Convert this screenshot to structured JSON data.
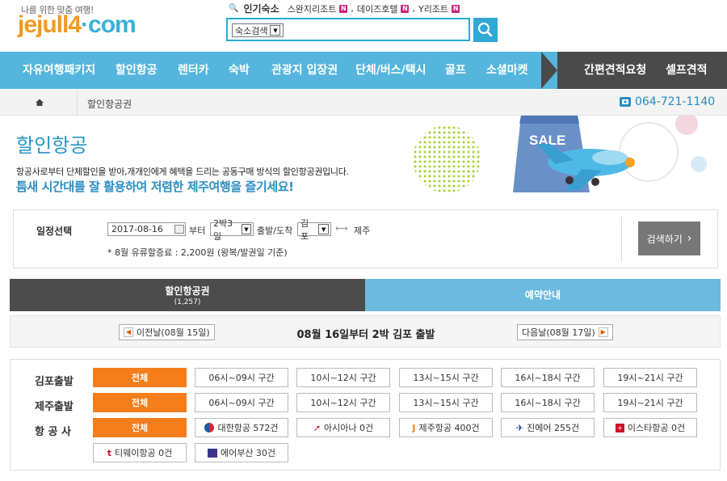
{
  "brand": {
    "tagline": "나를 위한 맞춤 여행!",
    "logo_a": "jejull4",
    "logo_dot": "·",
    "logo_b": "com"
  },
  "popular": {
    "title": "인기숙소",
    "items": [
      "스완지리조트",
      "데이즈호텔",
      "Y리조트"
    ],
    "badge": "N"
  },
  "search": {
    "select_value": "숙소검색"
  },
  "nav": {
    "items": [
      "자유여행패키지",
      "할인항공",
      "렌터카",
      "숙박",
      "관광지 입장권",
      "단체/버스/택시",
      "골프",
      "소셜마켓"
    ],
    "right": [
      "간편견적요청",
      "셀프견적"
    ]
  },
  "breadcrumb": {
    "current": "할인항공권",
    "phone": "064-721-1140"
  },
  "hero": {
    "title": "할인항공",
    "desc": "항공사로부터 단체할인을 받아,개개인에게 혜택을 드리는 공동구매 방식의 할인항공권입니다.",
    "slogan": "틈새 시간대를 잘 활용하여 저렴한 제주여행을 즐기세요!",
    "sale": "SALE"
  },
  "schedule": {
    "label": "일정선택",
    "date": "2017-08-16",
    "from": "부터",
    "nights": "2박3일",
    "depart_arrive": "출발/도착",
    "origin": "김포",
    "arrow": "⟷",
    "dest": "제주",
    "note": "* 8월 유류할증료 : 2,200원 (왕복/발권일 기준)",
    "search_btn": "검색하기"
  },
  "tabs": {
    "tab1": "할인항공권",
    "tab1_count": "(1,257)",
    "tab2": "예약안내"
  },
  "dayrow": {
    "prev": "이전날(08월 15일)",
    "title": "08월 16일부터 2박 김포 출발",
    "next": "다음날(08월 17일)"
  },
  "filters": {
    "gimpo": {
      "label": "김포출발",
      "all": "전체",
      "slots": [
        "06시~09시 구간",
        "10시~12시 구간",
        "13시~15시 구간",
        "16시~18시 구간",
        "19시~21시 구간"
      ]
    },
    "jeju": {
      "label": "제주출발",
      "all": "전체",
      "slots": [
        "06시~09시 구간",
        "10시~12시 구간",
        "13시~15시 구간",
        "16시~18시 구간",
        "19시~21시 구간"
      ]
    },
    "airline": {
      "label": "항 공 사",
      "all": "전체",
      "items": [
        "대한항공 572건",
        "아시아나 0건",
        "제주항공 400건",
        "진에어 255건",
        "이스타항공 0건",
        "티웨이항공 0건",
        "에어부산 30건"
      ]
    }
  },
  "colors": {
    "accent": "#2fa8d5",
    "orange": "#f47d1c",
    "nav": "#56b5dc"
  }
}
